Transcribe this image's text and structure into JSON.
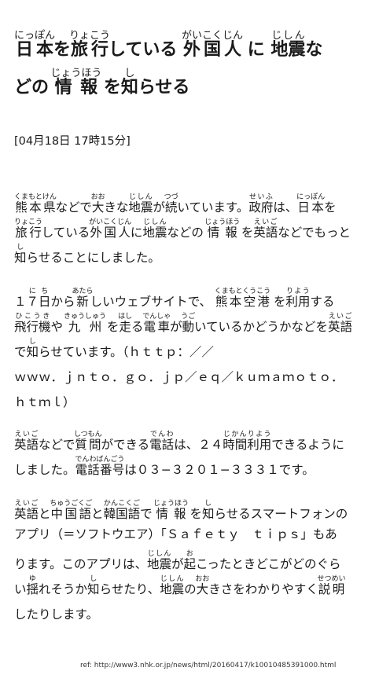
{
  "title": {
    "lines": [
      [
        {
          "t": " "
        },
        {
          "t": "日本",
          "r": "にっぽん"
        },
        {
          "t": "を"
        },
        {
          "t": "旅行",
          "r": "りょこう"
        },
        {
          "t": "している "
        },
        {
          "t": "外国人",
          "r": "がいこくじん"
        },
        {
          "t": " に "
        },
        {
          "t": "地震",
          "r": "じしん"
        },
        {
          "t": "な"
        }
      ],
      [
        {
          "t": "どの "
        },
        {
          "t": "情報",
          "r": "じょうほう"
        },
        {
          "t": " を"
        },
        {
          "t": "知",
          "r": "し"
        },
        {
          "t": "らせる"
        }
      ]
    ]
  },
  "date": "[04月18日 17時15分]",
  "paragraphs": [
    [
      [
        {
          "t": " "
        },
        {
          "t": "熊本県",
          "r": "くまもとけん"
        },
        {
          "t": "などで"
        },
        {
          "t": "大",
          "r": "おお"
        },
        {
          "t": "きな"
        },
        {
          "t": "地震",
          "r": "じしん"
        },
        {
          "t": "が"
        },
        {
          "t": "続",
          "r": "つづ"
        },
        {
          "t": "いています。"
        },
        {
          "t": "政府",
          "r": "せいふ"
        },
        {
          "t": "は、"
        },
        {
          "t": "日本",
          "r": "にっぽん"
        },
        {
          "t": "を"
        }
      ],
      [
        {
          "t": " "
        },
        {
          "t": "旅行",
          "r": "りょこう"
        },
        {
          "t": "している"
        },
        {
          "t": "外国人",
          "r": "がいこくじん"
        },
        {
          "t": "に"
        },
        {
          "t": "地震",
          "r": "じしん"
        },
        {
          "t": "などの "
        },
        {
          "t": "情報",
          "r": "じょうほう"
        },
        {
          "t": " を"
        },
        {
          "t": "英語",
          "r": "えいご"
        },
        {
          "t": "などでもっと"
        }
      ],
      [
        {
          "t": "知",
          "r": "し"
        },
        {
          "t": "らせることにしました。"
        }
      ]
    ],
    [
      [
        {
          "t": " １"
        },
        {
          "t": "７日",
          "r": "にち"
        },
        {
          "t": "から"
        },
        {
          "t": "新",
          "r": "あたら"
        },
        {
          "t": "しいウェブサイトで、 "
        },
        {
          "t": "熊本空港",
          "r": "くまもとくうこう"
        },
        {
          "t": " を"
        },
        {
          "t": "利用",
          "r": "りよう"
        },
        {
          "t": "する"
        }
      ],
      [
        {
          "t": "飛行機",
          "r": "ひこうき"
        },
        {
          "t": "や "
        },
        {
          "t": "九州",
          "r": "きゅうしゅう"
        },
        {
          "t": " を"
        },
        {
          "t": "走",
          "r": "はし"
        },
        {
          "t": "る"
        },
        {
          "t": "電車",
          "r": "でんしゃ"
        },
        {
          "t": "が"
        },
        {
          "t": "動",
          "r": "うご"
        },
        {
          "t": "いているかどうかなどを"
        },
        {
          "t": "英語",
          "r": "えいご"
        }
      ],
      [
        {
          "t": "で"
        },
        {
          "t": "知",
          "r": "し"
        },
        {
          "t": "らせています。（ｈｔｔｐ：／／"
        }
      ],
      [
        {
          "t": "ｗｗｗ．ｊｎｔｏ．ｇｏ．ｊｐ／ｅｑ／ｋｕｍａｍｏｔｏ．"
        }
      ],
      [
        {
          "t": "ｈｔｍｌ）"
        }
      ]
    ],
    [
      [
        {
          "t": "英語",
          "r": "えいご"
        },
        {
          "t": "などで"
        },
        {
          "t": "質問",
          "r": "しつもん"
        },
        {
          "t": "ができる"
        },
        {
          "t": "電話",
          "r": "でんわ"
        },
        {
          "t": "は、２４"
        },
        {
          "t": "時間",
          "r": "じかん"
        },
        {
          "t": "利用",
          "r": "りよう"
        },
        {
          "t": "できるように"
        }
      ],
      [
        {
          "t": "しました。"
        },
        {
          "t": "電話番号",
          "r": "でんわばんごう"
        },
        {
          "t": "は０３−３２０１−３３３１です。"
        }
      ]
    ],
    [
      [
        {
          "t": "英語",
          "r": "えいご"
        },
        {
          "t": "と"
        },
        {
          "t": "中国語",
          "r": "ちゅうごくご"
        },
        {
          "t": "と"
        },
        {
          "t": "韓国語",
          "r": "かんこくご"
        },
        {
          "t": "で "
        },
        {
          "t": "情報",
          "r": "じょうほう"
        },
        {
          "t": " を"
        },
        {
          "t": "知",
          "r": "し"
        },
        {
          "t": "らせるスマートフォンの"
        }
      ],
      [
        {
          "t": "アプリ（＝ソフトウエア）「Ｓａｆｅｔｙ　ｔｉｐｓ」もあ"
        }
      ],
      [
        {
          "t": "ります。このアプリは、"
        },
        {
          "t": "地震",
          "r": "じしん"
        },
        {
          "t": "が"
        },
        {
          "t": "起",
          "r": "お"
        },
        {
          "t": "こったときどこがどのぐら"
        }
      ],
      [
        {
          "t": "い"
        },
        {
          "t": "揺",
          "r": "ゆ"
        },
        {
          "t": "れそうか"
        },
        {
          "t": "知",
          "r": "し"
        },
        {
          "t": "らせたり、"
        },
        {
          "t": "地震",
          "r": "じしん"
        },
        {
          "t": "の"
        },
        {
          "t": "大",
          "r": "おお"
        },
        {
          "t": "きさをわかりやすく"
        },
        {
          "t": "説明",
          "r": "せつめい"
        }
      ],
      [
        {
          "t": "したりします。"
        }
      ]
    ]
  ],
  "ref": "ref: http://www3.nhk.or.jp/news/html/20160417/k10010485391000.html"
}
